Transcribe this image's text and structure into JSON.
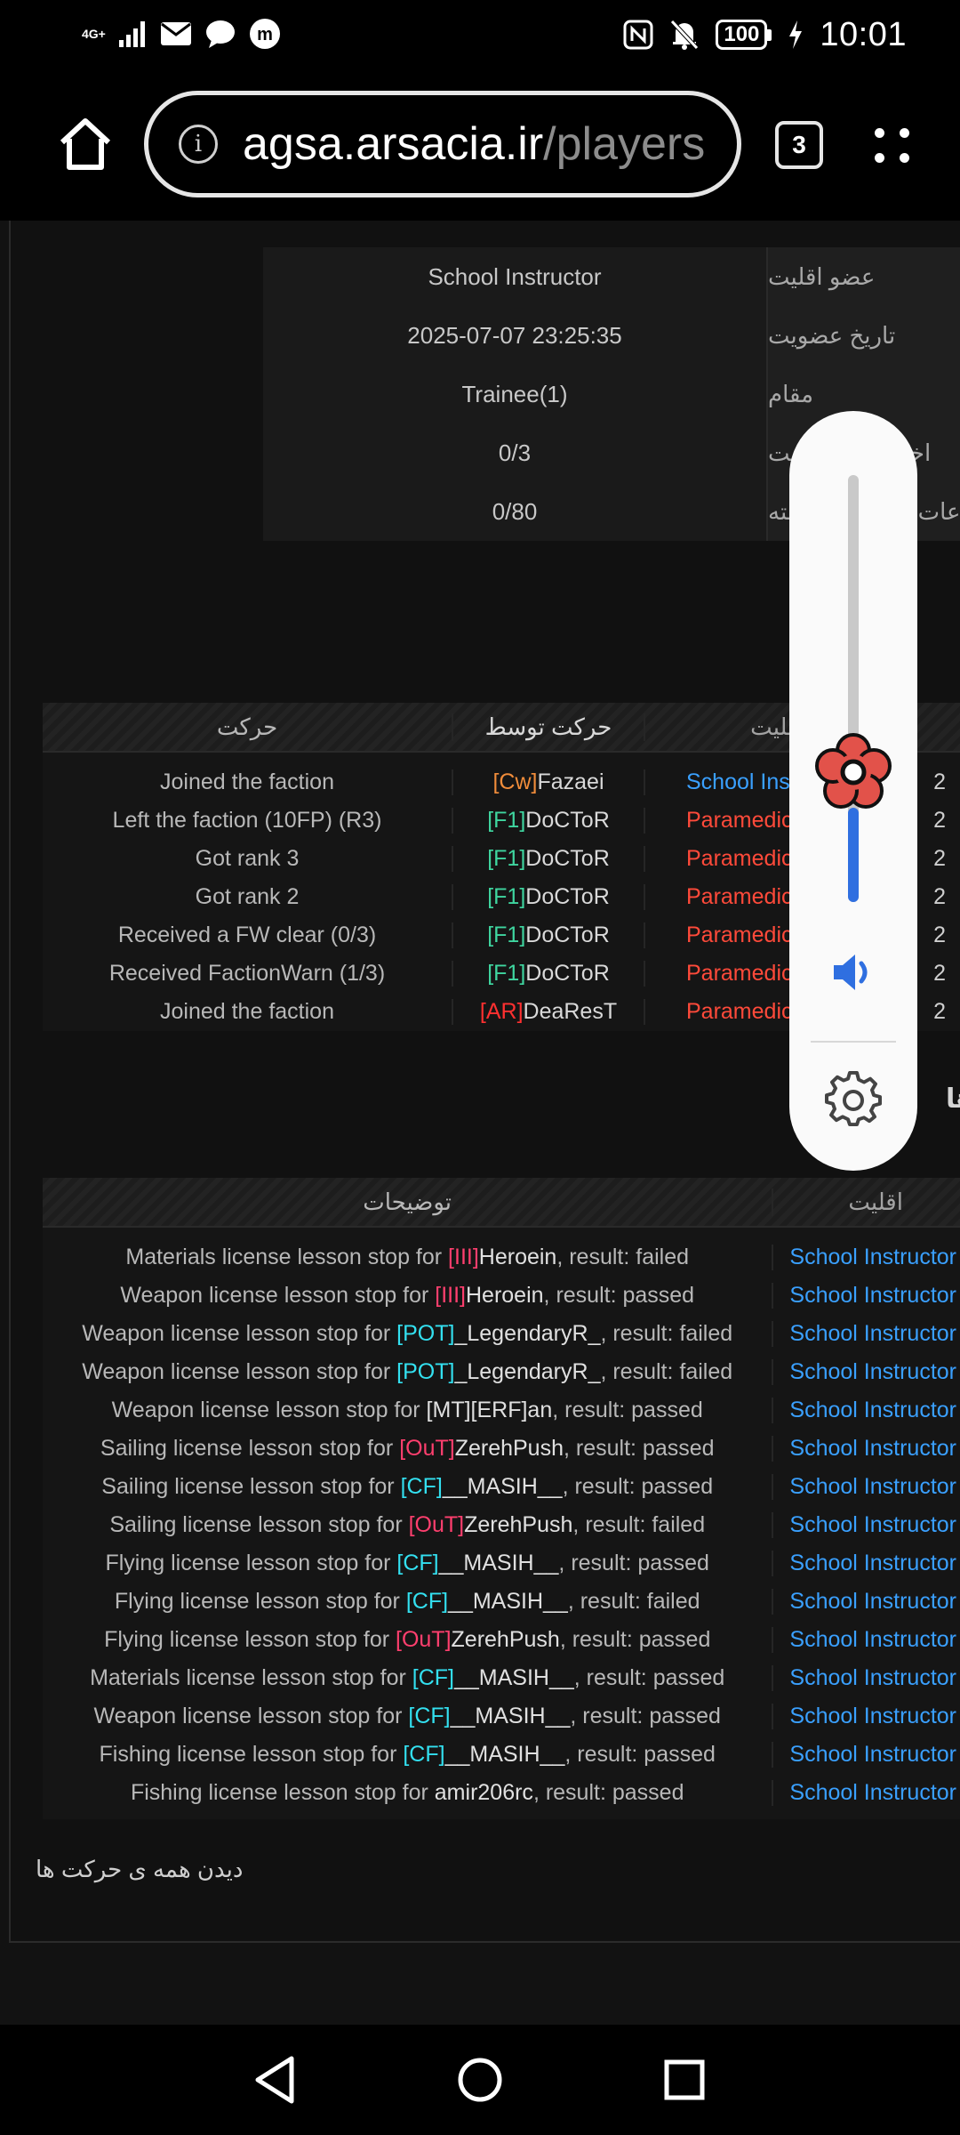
{
  "status_bar": {
    "network": "4G+",
    "battery": "100",
    "time": "10:01"
  },
  "browser": {
    "url_host": "agsa.arsacia.ir",
    "url_path": "/players",
    "tab_count": "3"
  },
  "profile": {
    "rows": [
      {
        "label": "عضو اقلیت",
        "value": "School Instructor"
      },
      {
        "label": "تاریخ عضویت",
        "value": "2025-07-07 23:25:35"
      },
      {
        "label": "مقام",
        "value": "Trainee(1)"
      },
      {
        "label": "اخطار های اقلیت",
        "value": "0/3"
      },
      {
        "label": "ساعات فعالیت در هفته",
        "value": "0/80"
      }
    ]
  },
  "faction_log": {
    "headers": {
      "action": "حرکت",
      "by": "حرکت توسط",
      "faction": "اقلیت"
    },
    "rows": [
      {
        "action": "Joined the faction",
        "by_tag": "[Cw]",
        "by_tag_color": "#f08c3a",
        "by_name": "Fazaei",
        "faction": "School Instructor",
        "faction_color": "#3aa0ff",
        "date": "2"
      },
      {
        "action": "Left the faction (10FP) (R3)",
        "by_tag": "[F1]",
        "by_tag_color": "#3fd6a0",
        "by_name": "DoCToR",
        "faction": "Paramedic",
        "faction_color": "#ff4a3a",
        "date": "2"
      },
      {
        "action": "Got rank 3",
        "by_tag": "[F1]",
        "by_tag_color": "#3fd6a0",
        "by_name": "DoCToR",
        "faction": "Paramedic",
        "faction_color": "#ff4a3a",
        "date": "2"
      },
      {
        "action": "Got rank 2",
        "by_tag": "[F1]",
        "by_tag_color": "#3fd6a0",
        "by_name": "DoCToR",
        "faction": "Paramedic",
        "faction_color": "#ff4a3a",
        "date": "2"
      },
      {
        "action": "Received a FW clear (0/3)",
        "by_tag": "[F1]",
        "by_tag_color": "#3fd6a0",
        "by_name": "DoCToR",
        "faction": "Paramedic",
        "faction_color": "#ff4a3a",
        "date": "2"
      },
      {
        "action": "Received FactionWarn (1/3)",
        "by_tag": "[F1]",
        "by_tag_color": "#3fd6a0",
        "by_name": "DoCToR",
        "faction": "Paramedic",
        "faction_color": "#ff4a3a",
        "date": "2"
      },
      {
        "action": "Joined the faction",
        "by_tag": "[AR]",
        "by_tag_color": "#ff3030",
        "by_name": "DeaResT",
        "faction": "Paramedic",
        "faction_color": "#ff4a3a",
        "date": "2"
      }
    ]
  },
  "section_heading_fragment": "ها",
  "activity_log": {
    "headers": {
      "desc": "توضیحات",
      "faction": "اقلیت"
    },
    "rows": [
      {
        "prefix": "Materials license lesson stop for ",
        "tag": "[III]",
        "tag_color": "#ff3f6e",
        "name": "Heroein",
        "suffix": ", result: failed",
        "faction": "School Instructor"
      },
      {
        "prefix": "Weapon license lesson stop for ",
        "tag": "[III]",
        "tag_color": "#ff3f6e",
        "name": "Heroein",
        "suffix": ", result: passed",
        "faction": "School Instructor"
      },
      {
        "prefix": "Weapon license lesson stop for ",
        "tag": "[POT]",
        "tag_color": "#33e0f0",
        "name": "_LegendaryR_",
        "suffix": ", result: failed",
        "faction": "School Instructor"
      },
      {
        "prefix": "Weapon license lesson stop for ",
        "tag": "[POT]",
        "tag_color": "#33e0f0",
        "name": "_LegendaryR_",
        "suffix": ", result: failed",
        "faction": "School Instructor"
      },
      {
        "prefix": "Weapon license lesson stop for ",
        "tag": "",
        "tag_color": "#b8b8b8",
        "name": "[MT][ERF]an",
        "suffix": ", result: passed",
        "faction": "School Instructor"
      },
      {
        "prefix": "Sailing license lesson stop for ",
        "tag": "[OuT]",
        "tag_color": "#ff3f6e",
        "name": "ZerehPush",
        "suffix": ", result: passed",
        "faction": "School Instructor"
      },
      {
        "prefix": "Sailing license lesson stop for ",
        "tag": "[CF]",
        "tag_color": "#33e0f0",
        "name": "__MASIH__",
        "suffix": ", result: passed",
        "faction": "School Instructor"
      },
      {
        "prefix": "Sailing license lesson stop for ",
        "tag": "[OuT]",
        "tag_color": "#ff3f6e",
        "name": "ZerehPush",
        "suffix": ", result: failed",
        "faction": "School Instructor"
      },
      {
        "prefix": "Flying license lesson stop for ",
        "tag": "[CF]",
        "tag_color": "#33e0f0",
        "name": "__MASIH__",
        "suffix": ", result: passed",
        "faction": "School Instructor"
      },
      {
        "prefix": "Flying license lesson stop for ",
        "tag": "[CF]",
        "tag_color": "#33e0f0",
        "name": "__MASIH__",
        "suffix": ", result: failed",
        "faction": "School Instructor"
      },
      {
        "prefix": "Flying license lesson stop for ",
        "tag": "[OuT]",
        "tag_color": "#ff3f6e",
        "name": "ZerehPush",
        "suffix": ", result: passed",
        "faction": "School Instructor"
      },
      {
        "prefix": "Materials license lesson stop for ",
        "tag": "[CF]",
        "tag_color": "#33e0f0",
        "name": "__MASIH__",
        "suffix": ", result: passed",
        "faction": "School Instructor"
      },
      {
        "prefix": "Weapon license lesson stop for ",
        "tag": "[CF]",
        "tag_color": "#33e0f0",
        "name": "__MASIH__",
        "suffix": ", result: passed",
        "faction": "School Instructor"
      },
      {
        "prefix": "Fishing license lesson stop for ",
        "tag": "[CF]",
        "tag_color": "#33e0f0",
        "name": "__MASIH__",
        "suffix": ", result: passed",
        "faction": "School Instructor"
      },
      {
        "prefix": "Fishing license lesson stop for ",
        "tag": "",
        "tag_color": "#b8b8b8",
        "name": "amir206rc",
        "suffix": ", result: passed",
        "faction": "School Instructor"
      }
    ]
  },
  "see_all_link": "دیدن همه ی حرکت ها",
  "volume": {
    "level": 0.22,
    "accent_color": "#2f6fe0",
    "thumb_color": "#e2524a",
    "speaker_icon": "speaker-icon",
    "settings_icon": "gear-icon"
  }
}
